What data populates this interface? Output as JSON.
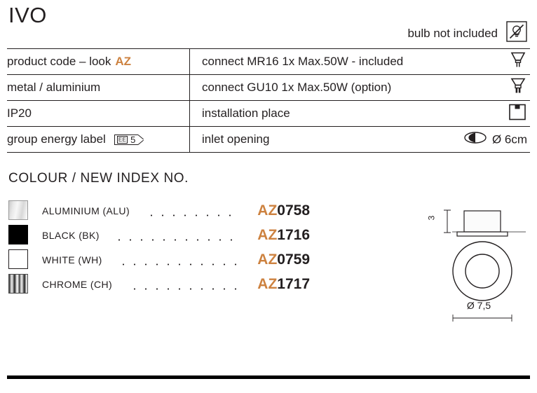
{
  "header": {
    "title": "IVO",
    "bulb_note": "bulb not included",
    "bulb_icon": "bulb-not-included-icon"
  },
  "spec_table": {
    "rows": [
      {
        "left": "product code – look",
        "left_accent": "AZ",
        "right": "connect MR16 1x Max.50W - included",
        "icon": "mr16-lamp-icon"
      },
      {
        "left": "metal / aluminium",
        "right": "connect GU10 1x Max.50W (option)",
        "icon": "gu10-lamp-icon"
      },
      {
        "left": "IP20",
        "right": "installation place",
        "icon": "ceiling-mount-icon"
      },
      {
        "left": "group energy label",
        "badge": {
          "prefix": "EE",
          "value": "5"
        },
        "right": "inlet opening",
        "icon": "inlet-opening-icon",
        "icon_text": "Ø 6cm"
      }
    ]
  },
  "colour_section": {
    "heading": "COLOUR / NEW INDEX NO.",
    "items": [
      {
        "name": "ALUMINIUM (ALU)",
        "code_prefix": "AZ",
        "code_number": "0758",
        "swatch": "aluminium-swatch"
      },
      {
        "name": "BLACK (BK)",
        "code_prefix": "AZ",
        "code_number": "1716",
        "swatch": "black-swatch"
      },
      {
        "name": "WHITE (WH)",
        "code_prefix": "AZ",
        "code_number": "0759",
        "swatch": "white-swatch"
      },
      {
        "name": "CHROME (CH)",
        "code_prefix": "AZ",
        "code_number": "1717",
        "swatch": "chrome-swatch"
      }
    ]
  },
  "tech_drawing": {
    "height_label": "3",
    "diameter_label": "Ø 7,5"
  },
  "colors": {
    "accent_orange": "#cd8240",
    "ink": "#231f20"
  }
}
